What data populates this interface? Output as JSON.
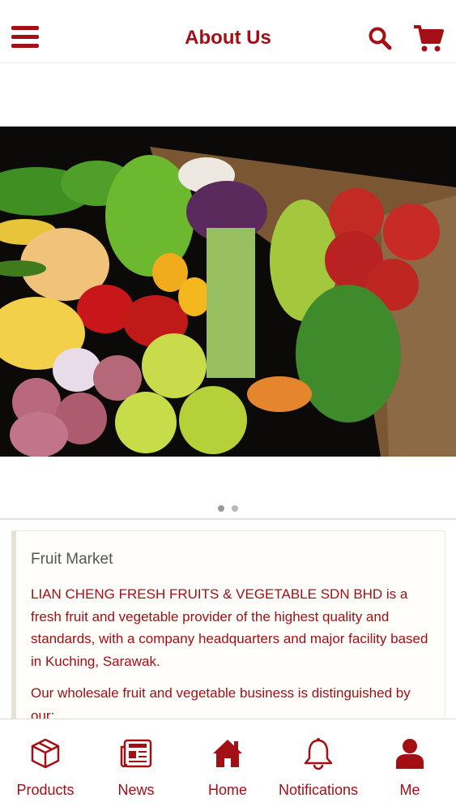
{
  "header": {
    "title": "About Us",
    "menu_icon": "hamburger-menu-icon",
    "search_icon": "search-icon",
    "cart_icon": "shopping-cart-icon"
  },
  "carousel": {
    "image": "fresh fruits and vegetables crate",
    "page_count": 2,
    "active_page": 1
  },
  "about": {
    "heading": "Fruit Market",
    "paragraph1": "LIAN CHENG FRESH FRUITS & VEGETABLE SDN BHD is a fresh fruit and vegetable provider of the highest quality and standards, with a company headquarters and major facility based in Kuching, Sarawak.",
    "paragraph2": "Our wholesale fruit and vegetable business is distinguished by our:"
  },
  "tabs": [
    {
      "label": "Products",
      "icon": "package-icon"
    },
    {
      "label": "News",
      "icon": "newspaper-icon"
    },
    {
      "label": "Home",
      "icon": "home-icon"
    },
    {
      "label": "Notifications",
      "icon": "bell-icon"
    },
    {
      "label": "Me",
      "icon": "user-icon"
    }
  ],
  "colors": {
    "accent": "#a30f14",
    "background": "#ffffff",
    "card_background": "#fffefb"
  }
}
